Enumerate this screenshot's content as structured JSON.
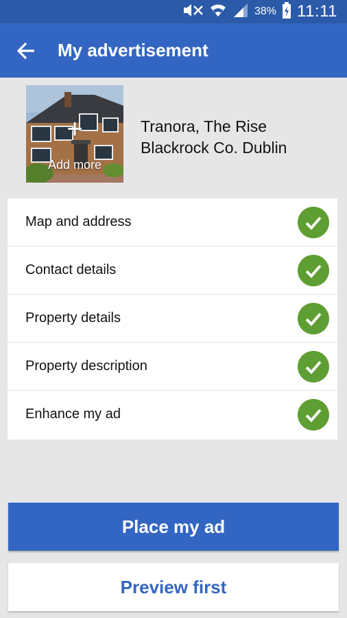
{
  "status_bar": {
    "battery_text": "38%",
    "time": "11:11",
    "icons": [
      "mute-icon",
      "wifi-icon",
      "signal-icon",
      "battery-charging-icon"
    ]
  },
  "app_bar": {
    "back_icon": "arrow-left-icon",
    "title": "My advertisement"
  },
  "property": {
    "photo_overlay": "Add more",
    "address_line1": "Tranora, The Rise",
    "address_line2": "Blackrock Co. Dublin"
  },
  "checklist": [
    {
      "label": "Map and address",
      "complete": true
    },
    {
      "label": "Contact details",
      "complete": true
    },
    {
      "label": "Property details",
      "complete": true
    },
    {
      "label": "Property description",
      "complete": true
    },
    {
      "label": "Enhance my ad",
      "complete": true
    }
  ],
  "actions": {
    "primary": "Place my ad",
    "secondary": "Preview first"
  },
  "colors": {
    "status_bar": "#2a5aa8",
    "app_bar": "#3366c2",
    "check": "#5e9e33",
    "background": "#e6e6e6"
  }
}
